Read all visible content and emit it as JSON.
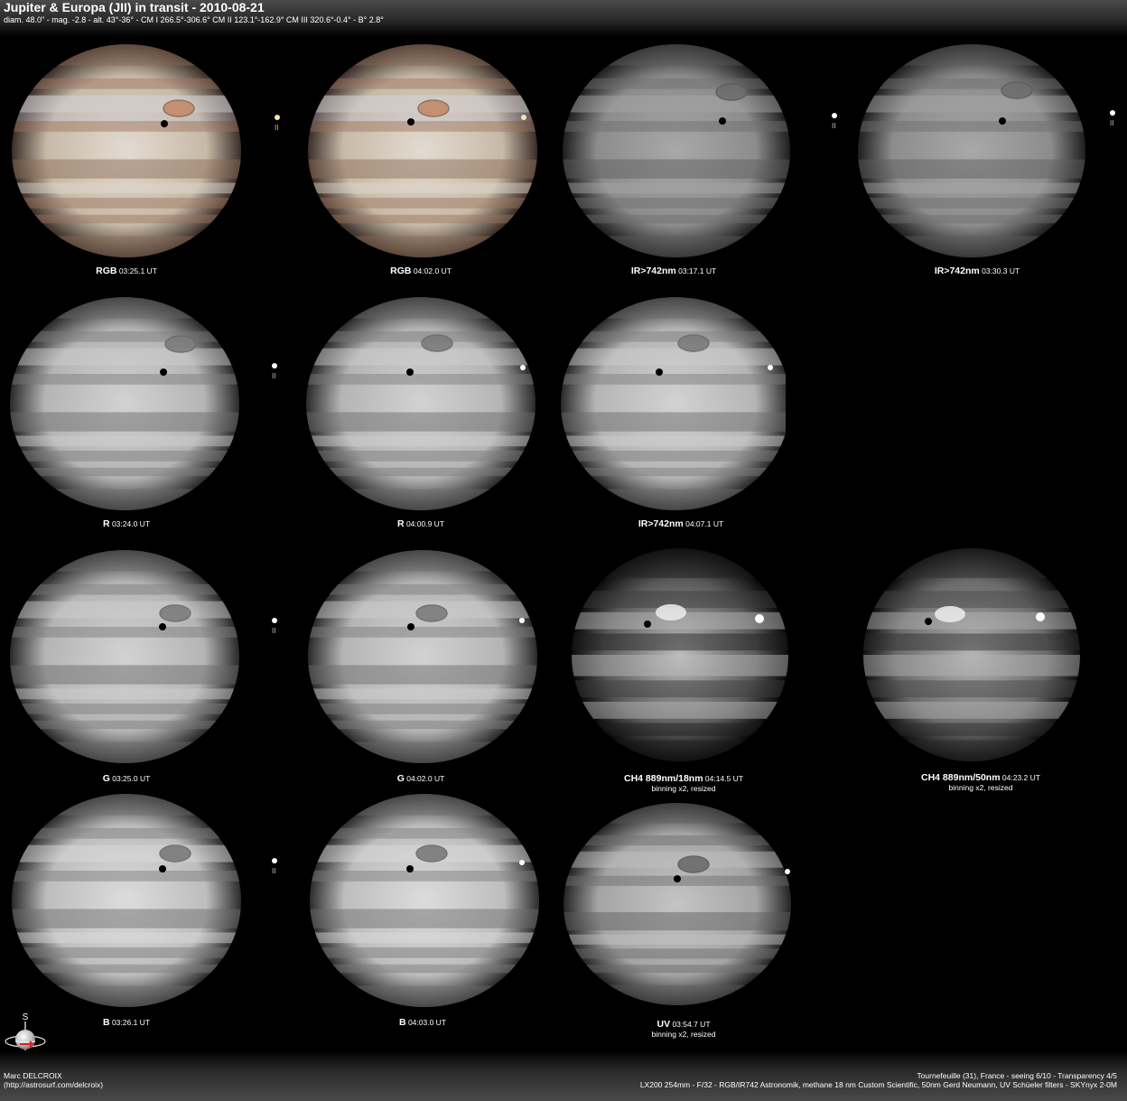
{
  "header": {
    "title": "Jupiter & Europa (JII) in transit - 2010-08-21",
    "subtitle": "diam. 48.0\" - mag. -2.8 - alt. 43°-36° - CM I 266.5°-306.6° CM II 123.1°-162.9° CM III 320.6°-0.4° - B° 2.8°"
  },
  "panels": [
    {
      "id": "rgb1",
      "filter": "RGB",
      "time": "03:25.1 UT",
      "note": "",
      "moon_label": "II",
      "style": "color"
    },
    {
      "id": "rgb2",
      "filter": "RGB",
      "time": "04:02.0 UT",
      "note": "",
      "moon_label": "",
      "style": "color"
    },
    {
      "id": "ir1",
      "filter": "IR>742nm",
      "time": "03:17.1 UT",
      "note": "",
      "moon_label": "II",
      "style": "ir"
    },
    {
      "id": "ir2",
      "filter": "IR>742nm",
      "time": "03:30.3 UT",
      "note": "",
      "moon_label": "II",
      "style": "ir"
    },
    {
      "id": "r1",
      "filter": "R",
      "time": "03:24.0 UT",
      "note": "",
      "moon_label": "II",
      "style": "gray"
    },
    {
      "id": "r2",
      "filter": "R",
      "time": "04:00.9 UT",
      "note": "",
      "moon_label": "",
      "style": "gray"
    },
    {
      "id": "ir3",
      "filter": "IR>742nm",
      "time": "04:07.1 UT",
      "note": "",
      "moon_label": "",
      "style": "gray"
    },
    {
      "id": "g1",
      "filter": "G",
      "time": "03:25.0 UT",
      "note": "",
      "moon_label": "II",
      "style": "gray"
    },
    {
      "id": "g2",
      "filter": "G",
      "time": "04:02.0 UT",
      "note": "",
      "moon_label": "",
      "style": "gray"
    },
    {
      "id": "ch41",
      "filter": "CH4 889nm/18nm",
      "time": "04:14.5 UT",
      "note": "binning x2, resized",
      "moon_label": "",
      "style": "ch4a"
    },
    {
      "id": "ch42",
      "filter": "CH4 889nm/50nm",
      "time": "04:23.2 UT",
      "note": "binning x2, resized",
      "moon_label": "",
      "style": "ch4b"
    },
    {
      "id": "b1",
      "filter": "B",
      "time": "03:26.1 UT",
      "note": "",
      "moon_label": "II",
      "style": "blue"
    },
    {
      "id": "b2",
      "filter": "B",
      "time": "04:03.0 UT",
      "note": "",
      "moon_label": "",
      "style": "blue"
    },
    {
      "id": "uv",
      "filter": "UV",
      "time": "03:54.7 UT",
      "note": "binning x2, resized",
      "moon_label": "",
      "style": "uv"
    }
  ],
  "compass": {
    "label": "S",
    "arrow_color": "#e02020"
  },
  "footer": {
    "author": "Marc DELCROIX",
    "website": "(http://astrosurf.com/delcroix)",
    "location": "Tournefeuille (31), France - seeing 6/10 - Transparency 4/5",
    "equipment": "LX200 254mm - F/32 -  RGB/IR742 Astronomik, methane 18 nm Custom Scientific, 50nm Gerd Neumann, UV Schüeler filters - SKYnyx 2-0M"
  }
}
